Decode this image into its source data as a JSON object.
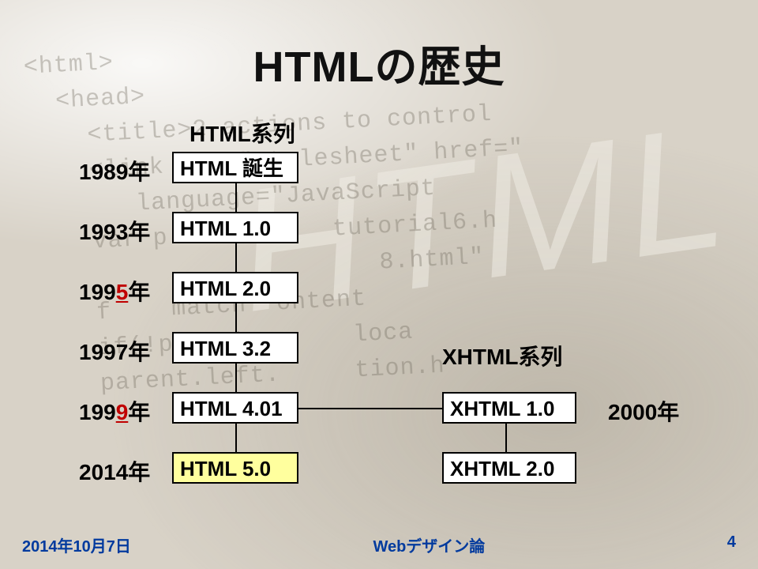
{
  "title": "HTMLの歴史",
  "branch_labels": {
    "html": "HTML系列",
    "xhtml": "XHTML系列"
  },
  "years": {
    "y1989": "1989年",
    "y1993": "1993年",
    "y1995_a": "199",
    "y1995_b": "5",
    "y1995_c": "年",
    "y1997": "1997年",
    "y1999_a": "199",
    "y1999_b": "9",
    "y1999_c": "年",
    "y2014": "2014年",
    "y2000": "2000年"
  },
  "nodes": {
    "birth": "HTML 誕生",
    "h10": "HTML 1.0",
    "h20": "HTML 2.0",
    "h32": "HTML 3.2",
    "h401": "HTML 4.01",
    "h50": "HTML 5.0",
    "x10": "XHTML 1.0",
    "x20": "XHTML 2.0"
  },
  "bg_code": "<html>\n  <head>\n    <title>2 actions to control\n    <link rel=\"stylesheet\" href=\"\n       language=\"JavaScript\n    var p   ous  \"  tutorial6.h\n                       8.html\"\n    f    match  ontent\n    if(!parent       loca\n    parent.left.     tion.h",
  "bg_big": "HTML",
  "footer": {
    "date": "2014年10月7日",
    "course": "Webデザイン論",
    "page": "4"
  }
}
